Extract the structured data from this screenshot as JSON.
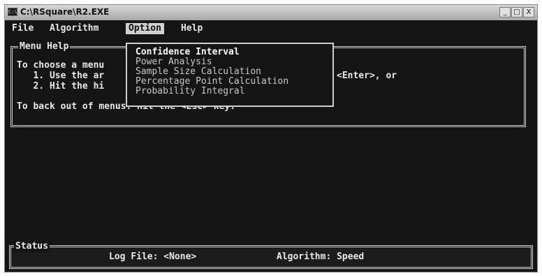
{
  "window": {
    "title": "C:\\RSquare\\R2.EXE",
    "buttons": {
      "minimize": "_",
      "maximize": "□",
      "close": "X"
    }
  },
  "menubar": [
    "File",
    "Algorithm",
    "Option",
    "Help"
  ],
  "menu_help": {
    "frame_title": "Menu Help",
    "lines": [
      "To choose a menu",
      "   1. Use the ar",
      "   2. Hit the hi",
      "To back out of menus: Hit the <Esc> key."
    ],
    "line2_tail": "<Enter>, or"
  },
  "option_menu": {
    "items": [
      "Confidence Interval",
      "Power Analysis",
      "Sample Size Calculation",
      "Percentage Point Calculation",
      "Probability Integral"
    ],
    "selected": "Confidence Interval"
  },
  "status": {
    "frame_title": "Status",
    "log_file": "Log File: <None>",
    "algorithm": "Algorithm: Speed"
  },
  "colors": {
    "console_bg": "#151515",
    "console_text": "#e8e8e8",
    "frame": "#cfcfcf"
  }
}
